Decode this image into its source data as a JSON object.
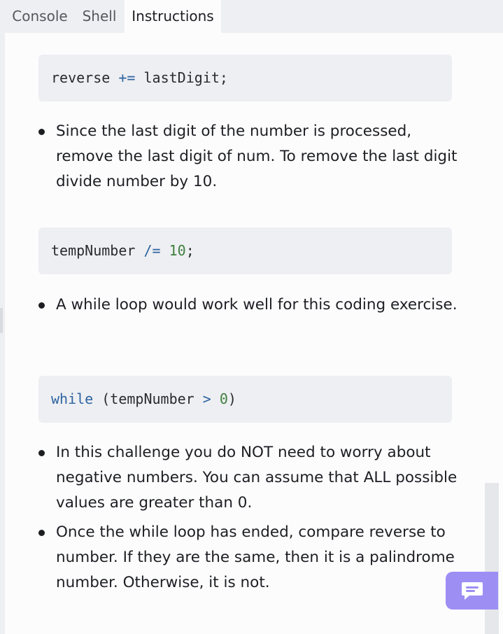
{
  "tabs": [
    {
      "label": "Console",
      "active": false
    },
    {
      "label": "Shell",
      "active": false
    },
    {
      "label": "Instructions",
      "active": true
    }
  ],
  "content": {
    "code1": {
      "var": "reverse",
      "op": "+=",
      "rest": "lastDigit;"
    },
    "bullet1": "Since the last digit of the number is processed, remove the last digit of num. To remove the last digit divide number by 10.",
    "code2": {
      "var": "tempNumber",
      "op": "/=",
      "num": "10",
      "end": ";"
    },
    "bullet2": "A while loop would work well for this coding exercise.",
    "code3": {
      "kw": "while",
      "open": "(tempNumber",
      "op": ">",
      "num": "0",
      "close": ")"
    },
    "bullet3": "In this challenge you do NOT need to worry about negative numbers. You can assume that ALL possible values are greater than 0.",
    "bullet4": "Once the while loop has ended, compare reverse to number. If they are the same, then it is a palindrome number. Otherwise, it is not."
  },
  "chat_button": {
    "icon": "chat-icon",
    "color": "#9d8ef4"
  },
  "colors": {
    "keyword": "#2d63a1",
    "number": "#3f7f3f",
    "code_bg": "#eeeff2"
  }
}
